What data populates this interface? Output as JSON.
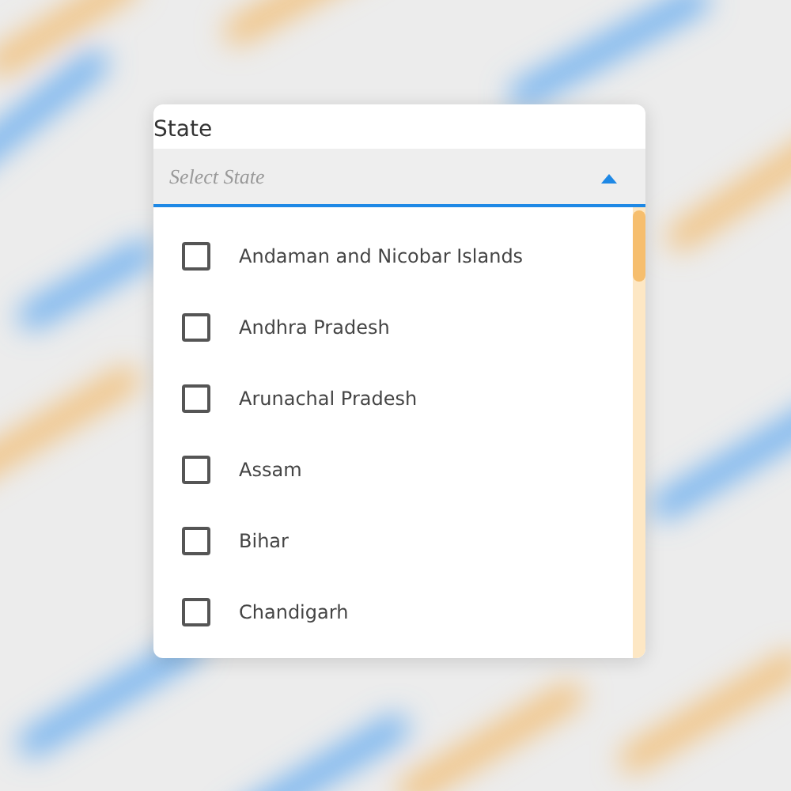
{
  "field": {
    "label": "State",
    "placeholder": "Select State",
    "expanded": true
  },
  "options": [
    {
      "label": "Andaman and Nicobar Islands",
      "checked": false
    },
    {
      "label": "Andhra Pradesh",
      "checked": false
    },
    {
      "label": "Arunachal Pradesh",
      "checked": false
    },
    {
      "label": "Assam",
      "checked": false
    },
    {
      "label": "Bihar",
      "checked": false
    },
    {
      "label": "Chandigarh",
      "checked": false
    }
  ]
}
